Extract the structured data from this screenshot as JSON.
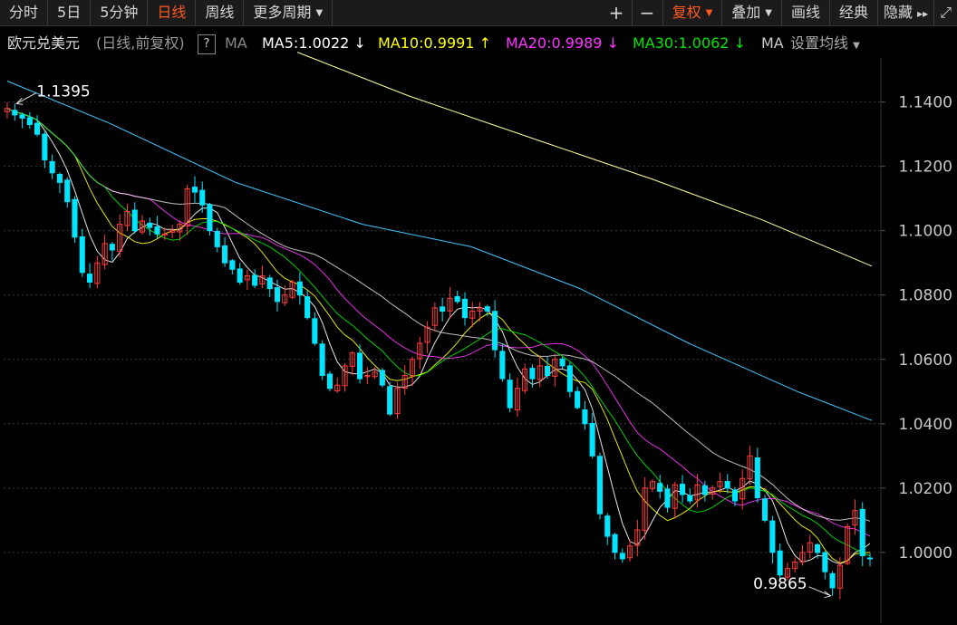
{
  "toolbar": {
    "left": [
      "分时",
      "5日",
      "5分钟",
      "日线",
      "周线",
      "更多周期"
    ],
    "active": "日线",
    "right": [
      "+",
      "−",
      "复权",
      "叠加",
      "画线",
      "经典",
      "隐藏"
    ],
    "more_arrows": "▸▸",
    "extra_icon": "⤢"
  },
  "legend": {
    "name": "欧元兑美元",
    "mode": "(日线,前复权)",
    "help": "?",
    "ma_label": "MA",
    "ma5": "MA5:1.0022",
    "ma10": "MA10:0.9991",
    "ma20": "MA20:0.9989",
    "ma30": "MA30:1.0062",
    "ma_more": "MA",
    "settings": "设置均线",
    "colors": {
      "ma5": "#ffffff",
      "ma10": "#ffff00",
      "ma20": "#ff33ff",
      "ma30": "#00e600"
    }
  },
  "chart_data": {
    "type": "candlestick",
    "title": "欧元兑美元",
    "ylim": [
      0.978,
      1.152
    ],
    "yticks": [
      "1.1400",
      "1.1200",
      "1.1000",
      "1.0800",
      "1.0600",
      "1.0400",
      "1.0200",
      "1.0000"
    ],
    "ytick_values": [
      1.14,
      1.12,
      1.1,
      1.08,
      1.06,
      1.04,
      1.02,
      1.0
    ],
    "high_annotation": {
      "label": "1.1395",
      "value": 1.1395
    },
    "low_annotation": {
      "label": "0.9865",
      "value": 0.9865
    },
    "up_color": "#ff3c3c",
    "down_color": "#00e5ff",
    "closes": [
      1.138,
      1.136,
      1.135,
      1.133,
      1.13,
      1.122,
      1.118,
      1.115,
      1.109,
      1.098,
      1.087,
      1.084,
      1.09,
      1.096,
      1.094,
      1.102,
      1.106,
      1.1,
      1.103,
      1.101,
      1.099,
      1.099,
      1.1,
      1.102,
      1.113,
      1.112,
      1.108,
      1.1,
      1.095,
      1.09,
      1.088,
      1.084,
      1.086,
      1.083,
      1.086,
      1.082,
      1.078,
      1.08,
      1.084,
      1.08,
      1.073,
      1.065,
      1.055,
      1.051,
      1.052,
      1.058,
      1.062,
      1.054,
      1.055,
      1.056,
      1.052,
      1.043,
      1.051,
      1.055,
      1.06,
      1.065,
      1.07,
      1.076,
      1.075,
      1.079,
      1.078,
      1.073,
      1.075,
      1.076,
      1.075,
      1.063,
      1.054,
      1.045,
      1.051,
      1.057,
      1.054,
      1.058,
      1.055,
      1.06,
      1.058,
      1.05,
      1.045,
      1.04,
      1.03,
      1.012,
      1.005,
      1.0,
      0.998,
      1.002,
      1.007,
      1.02,
      1.022,
      1.019,
      1.014,
      1.021,
      1.018,
      1.016,
      1.021,
      1.018,
      1.02,
      1.022,
      1.02,
      1.016,
      1.023,
      1.03,
      1.017,
      1.01,
      1.0,
      0.993,
      0.995,
      0.997,
      1.0,
      1.003,
      1.0,
      0.994,
      0.989,
      0.996,
      1.008,
      1.013,
      0.999,
      0.998
    ],
    "ma5_level": 1.0022,
    "ma10_level": 0.9991,
    "ma20_level": 0.9989,
    "ma30_level": 1.0062
  }
}
